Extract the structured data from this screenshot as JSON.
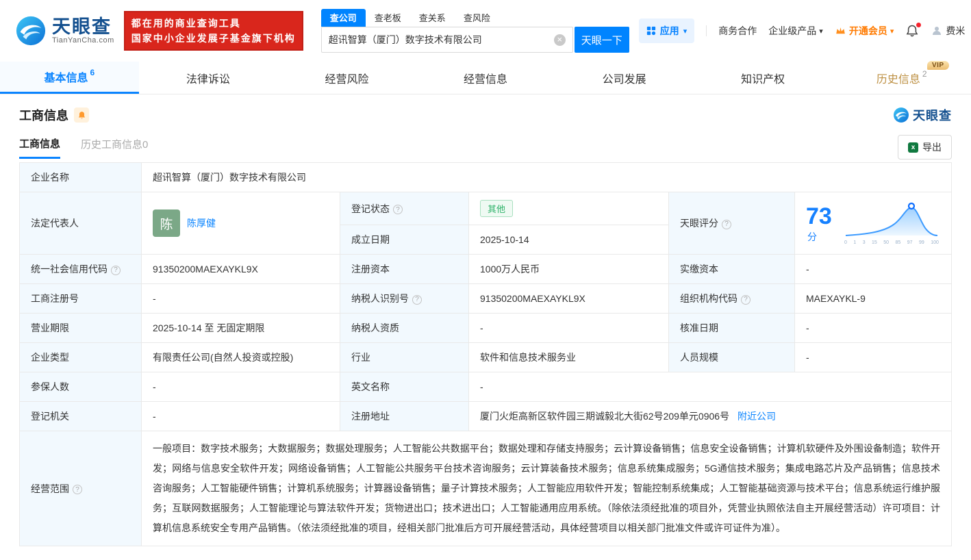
{
  "header": {
    "logo": {
      "title": "天眼查",
      "domain": "TianYanCha.com"
    },
    "slogan_line1": "都在用的商业查询工具",
    "slogan_line2": "国家中小企业发展子基金旗下机构",
    "search_tabs": [
      {
        "label": "查公司"
      },
      {
        "label": "查老板"
      },
      {
        "label": "查关系"
      },
      {
        "label": "查风险"
      }
    ],
    "search": {
      "value": "超讯智算（厦门）数字技术有限公司"
    },
    "search_button": "天眼一下",
    "menu": {
      "apps": "应用",
      "cooperation": "商务合作",
      "enterprise": "企业级产品",
      "vip": "开通会员",
      "user": "费米"
    }
  },
  "nav_tabs": [
    {
      "label": "基本信息",
      "count": "6"
    },
    {
      "label": "法律诉讼"
    },
    {
      "label": "经营风险"
    },
    {
      "label": "经营信息"
    },
    {
      "label": "公司发展"
    },
    {
      "label": "知识产权"
    },
    {
      "label": "历史信息",
      "count": "2",
      "badge": "VIP"
    }
  ],
  "section": {
    "title": "工商信息",
    "watermark": "天眼查",
    "tab_current": "工商信息",
    "tab_history": "历史工商信息",
    "tab_history_count": "0",
    "export_label": "导出"
  },
  "fields": {
    "company_name": {
      "label": "企业名称",
      "value": "超讯智算（厦门）数字技术有限公司"
    },
    "legal_rep": {
      "label": "法定代表人",
      "avatar": "陈",
      "name": "陈厚健"
    },
    "reg_status": {
      "label": "登记状态",
      "value": "其他"
    },
    "establish_date": {
      "label": "成立日期",
      "value": "2025-10-14"
    },
    "score": {
      "label": "天眼评分",
      "value": "73",
      "unit": "分",
      "ticks": [
        "0",
        "1",
        "3",
        "15",
        "50",
        "85",
        "97",
        "99",
        "100"
      ]
    },
    "credit_code": {
      "label": "统一社会信用代码",
      "value": "91350200MAEXAYKL9X"
    },
    "reg_capital": {
      "label": "注册资本",
      "value": "1000万人民币"
    },
    "paid_capital": {
      "label": "实缴资本",
      "value": "-"
    },
    "reg_number": {
      "label": "工商注册号",
      "value": "-"
    },
    "taxpayer_id": {
      "label": "纳税人识别号",
      "value": "91350200MAEXAYKL9X"
    },
    "org_code": {
      "label": "组织机构代码",
      "value": "MAEXAYKL-9"
    },
    "business_term": {
      "label": "营业期限",
      "value": "2025-10-14 至 无固定期限"
    },
    "taxpayer_quality": {
      "label": "纳税人资质",
      "value": "-"
    },
    "approval_date": {
      "label": "核准日期",
      "value": "-"
    },
    "company_type": {
      "label": "企业类型",
      "value": "有限责任公司(自然人投资或控股)"
    },
    "industry": {
      "label": "行业",
      "value": "软件和信息技术服务业"
    },
    "staff_size": {
      "label": "人员规模",
      "value": "-"
    },
    "insured_count": {
      "label": "参保人数",
      "value": "-"
    },
    "english_name": {
      "label": "英文名称",
      "value": "-"
    },
    "reg_authority": {
      "label": "登记机关",
      "value": "-"
    },
    "reg_address": {
      "label": "注册地址",
      "value": "厦门火炬高新区软件园三期诚毅北大街62号209单元0906号",
      "link": "附近公司"
    },
    "business_scope": {
      "label": "经营范围",
      "value": "一般项目：数字技术服务；大数据服务；数据处理服务；人工智能公共数据平台；数据处理和存储支持服务；云计算设备销售；信息安全设备销售；计算机软硬件及外围设备制造；软件开发；网络与信息安全软件开发；网络设备销售；人工智能公共服务平台技术咨询服务；云计算装备技术服务；信息系统集成服务；5G通信技术服务；集成电路芯片及产品销售；信息技术咨询服务；人工智能硬件销售；计算机系统服务；计算器设备销售；量子计算技术服务；人工智能应用软件开发；智能控制系统集成；人工智能基础资源与技术平台；信息系统运行维护服务；互联网数据服务；人工智能理论与算法软件开发；货物进出口；技术进出口；人工智能通用应用系统。（除依法须经批准的项目外，凭营业执照依法自主开展经营活动）许可项目：计算机信息系统安全专用产品销售。（依法须经批准的项目，经相关部门批准后方可开展经营活动，具体经营项目以相关部门批准文件或许可证件为准）。"
    }
  },
  "icons": {
    "help": "?",
    "clear": "×",
    "caret": "▾",
    "excel": "x"
  },
  "colors": {
    "accent": "#0084ff",
    "brand_red": "#d9261c",
    "vip_orange": "#ff7a00",
    "history_gold": "#bd9043",
    "status_green": "#2eb269"
  }
}
